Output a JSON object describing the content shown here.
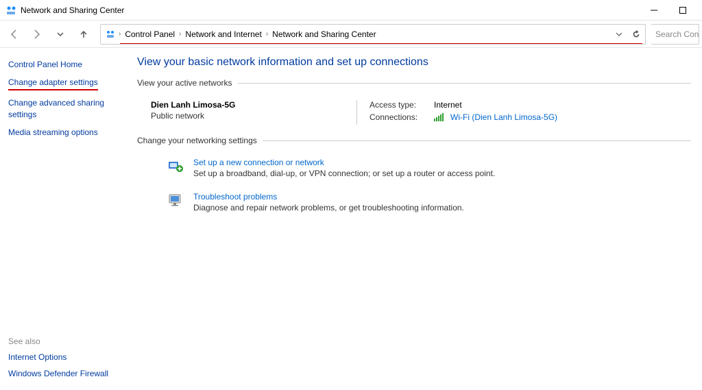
{
  "window": {
    "title": "Network and Sharing Center"
  },
  "breadcrumb": {
    "items": [
      "Control Panel",
      "Network and Internet",
      "Network and Sharing Center"
    ]
  },
  "search": {
    "placeholder": "Search Contr"
  },
  "sidebar": {
    "items": [
      "Control Panel Home",
      "Change adapter settings",
      "Change advanced sharing settings",
      "Media streaming options"
    ],
    "see_also_label": "See also",
    "see_also": [
      "Internet Options",
      "Windows Defender Firewall"
    ]
  },
  "main": {
    "heading": "View your basic network information and set up connections",
    "active_networks_label": "View your active networks",
    "network": {
      "name": "Dien Lanh Limosa-5G",
      "type": "Public network",
      "access_type_label": "Access type:",
      "access_type_value": "Internet",
      "connections_label": "Connections:",
      "connection_link": "Wi-Fi (Dien Lanh Limosa-5G)"
    },
    "change_settings_label": "Change your networking settings",
    "options": [
      {
        "title": "Set up a new connection or network",
        "desc": "Set up a broadband, dial-up, or VPN connection; or set up a router or access point."
      },
      {
        "title": "Troubleshoot problems",
        "desc": "Diagnose and repair network problems, or get troubleshooting information."
      }
    ]
  }
}
